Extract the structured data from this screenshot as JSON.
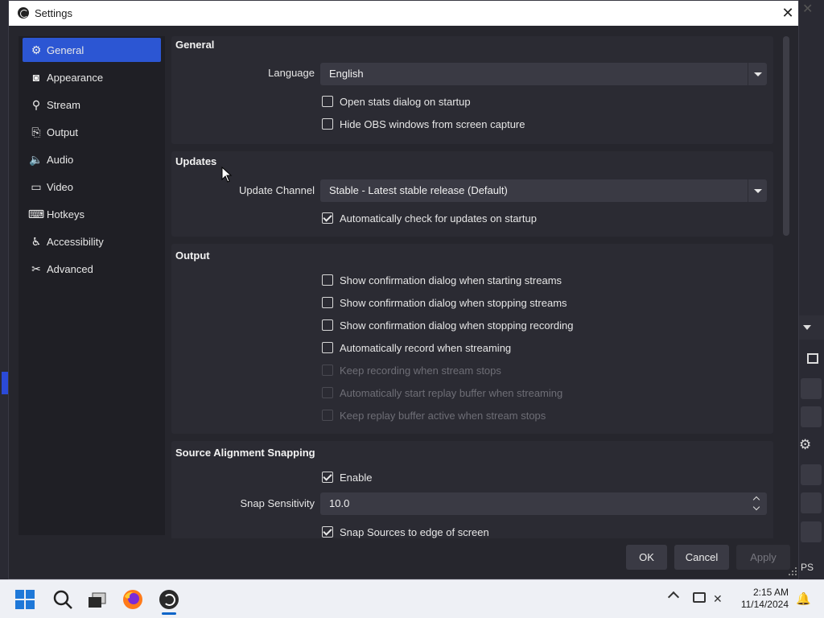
{
  "dialog": {
    "title": "Settings",
    "close_glyph": "✕"
  },
  "sidebar": {
    "items": [
      {
        "label": "General",
        "icon": "gear-icon",
        "glyph": "⚙",
        "active": true
      },
      {
        "label": "Appearance",
        "icon": "appearance-icon",
        "glyph": "◙",
        "active": false
      },
      {
        "label": "Stream",
        "icon": "antenna-icon",
        "glyph": "⚲",
        "active": false
      },
      {
        "label": "Output",
        "icon": "output-icon",
        "glyph": "⎘",
        "active": false
      },
      {
        "label": "Audio",
        "icon": "speaker-icon",
        "glyph": "🔈",
        "active": false
      },
      {
        "label": "Video",
        "icon": "monitor-icon",
        "glyph": "▭",
        "active": false
      },
      {
        "label": "Hotkeys",
        "icon": "keyboard-icon",
        "glyph": "⌨",
        "active": false
      },
      {
        "label": "Accessibility",
        "icon": "accessibility-icon",
        "glyph": "♿",
        "active": false
      },
      {
        "label": "Advanced",
        "icon": "tools-icon",
        "glyph": "✂",
        "active": false
      }
    ]
  },
  "general": {
    "title": "General",
    "language_label": "Language",
    "language_value": "English",
    "open_stats": {
      "label": "Open stats dialog on startup",
      "checked": false
    },
    "hide_obs": {
      "label": "Hide OBS windows from screen capture",
      "checked": false
    }
  },
  "updates": {
    "title": "Updates",
    "channel_label": "Update Channel",
    "channel_value": "Stable - Latest stable release (Default)",
    "auto_check": {
      "label": "Automatically check for updates on startup",
      "checked": true
    }
  },
  "output": {
    "title": "Output",
    "options": [
      {
        "label": "Show confirmation dialog when starting streams",
        "checked": false,
        "disabled": false
      },
      {
        "label": "Show confirmation dialog when stopping streams",
        "checked": false,
        "disabled": false
      },
      {
        "label": "Show confirmation dialog when stopping recording",
        "checked": false,
        "disabled": false
      },
      {
        "label": "Automatically record when streaming",
        "checked": false,
        "disabled": false
      },
      {
        "label": "Keep recording when stream stops",
        "checked": false,
        "disabled": true
      },
      {
        "label": "Automatically start replay buffer when streaming",
        "checked": false,
        "disabled": true
      },
      {
        "label": "Keep replay buffer active when stream stops",
        "checked": false,
        "disabled": true
      }
    ]
  },
  "snapping": {
    "title": "Source Alignment Snapping",
    "enable": {
      "label": "Enable",
      "checked": true
    },
    "sensitivity_label": "Snap Sensitivity",
    "sensitivity_value": "10.0",
    "snap_edge": {
      "label": "Snap Sources to edge of screen",
      "checked": true
    }
  },
  "buttons": {
    "ok": "OK",
    "cancel": "Cancel",
    "apply": "Apply"
  },
  "background": {
    "fps_text": "PS"
  },
  "taskbar": {
    "time": "2:15 AM",
    "date": "11/14/2024"
  }
}
